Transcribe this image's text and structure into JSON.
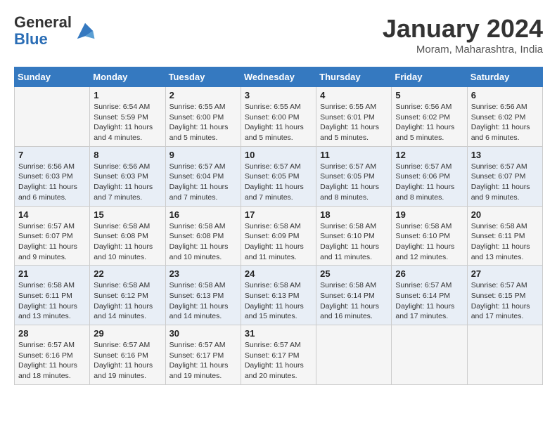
{
  "header": {
    "logo": {
      "line1": "General",
      "line2": "Blue"
    },
    "title": "January 2024",
    "location": "Moram, Maharashtra, India"
  },
  "weekdays": [
    "Sunday",
    "Monday",
    "Tuesday",
    "Wednesday",
    "Thursday",
    "Friday",
    "Saturday"
  ],
  "weeks": [
    [
      {
        "day": "",
        "info": ""
      },
      {
        "day": "1",
        "info": "Sunrise: 6:54 AM\nSunset: 5:59 PM\nDaylight: 11 hours\nand 4 minutes."
      },
      {
        "day": "2",
        "info": "Sunrise: 6:55 AM\nSunset: 6:00 PM\nDaylight: 11 hours\nand 5 minutes."
      },
      {
        "day": "3",
        "info": "Sunrise: 6:55 AM\nSunset: 6:00 PM\nDaylight: 11 hours\nand 5 minutes."
      },
      {
        "day": "4",
        "info": "Sunrise: 6:55 AM\nSunset: 6:01 PM\nDaylight: 11 hours\nand 5 minutes."
      },
      {
        "day": "5",
        "info": "Sunrise: 6:56 AM\nSunset: 6:02 PM\nDaylight: 11 hours\nand 5 minutes."
      },
      {
        "day": "6",
        "info": "Sunrise: 6:56 AM\nSunset: 6:02 PM\nDaylight: 11 hours\nand 6 minutes."
      }
    ],
    [
      {
        "day": "7",
        "info": "Sunrise: 6:56 AM\nSunset: 6:03 PM\nDaylight: 11 hours\nand 6 minutes."
      },
      {
        "day": "8",
        "info": "Sunrise: 6:56 AM\nSunset: 6:03 PM\nDaylight: 11 hours\nand 7 minutes."
      },
      {
        "day": "9",
        "info": "Sunrise: 6:57 AM\nSunset: 6:04 PM\nDaylight: 11 hours\nand 7 minutes."
      },
      {
        "day": "10",
        "info": "Sunrise: 6:57 AM\nSunset: 6:05 PM\nDaylight: 11 hours\nand 7 minutes."
      },
      {
        "day": "11",
        "info": "Sunrise: 6:57 AM\nSunset: 6:05 PM\nDaylight: 11 hours\nand 8 minutes."
      },
      {
        "day": "12",
        "info": "Sunrise: 6:57 AM\nSunset: 6:06 PM\nDaylight: 11 hours\nand 8 minutes."
      },
      {
        "day": "13",
        "info": "Sunrise: 6:57 AM\nSunset: 6:07 PM\nDaylight: 11 hours\nand 9 minutes."
      }
    ],
    [
      {
        "day": "14",
        "info": "Sunrise: 6:57 AM\nSunset: 6:07 PM\nDaylight: 11 hours\nand 9 minutes."
      },
      {
        "day": "15",
        "info": "Sunrise: 6:58 AM\nSunset: 6:08 PM\nDaylight: 11 hours\nand 10 minutes."
      },
      {
        "day": "16",
        "info": "Sunrise: 6:58 AM\nSunset: 6:08 PM\nDaylight: 11 hours\nand 10 minutes."
      },
      {
        "day": "17",
        "info": "Sunrise: 6:58 AM\nSunset: 6:09 PM\nDaylight: 11 hours\nand 11 minutes."
      },
      {
        "day": "18",
        "info": "Sunrise: 6:58 AM\nSunset: 6:10 PM\nDaylight: 11 hours\nand 11 minutes."
      },
      {
        "day": "19",
        "info": "Sunrise: 6:58 AM\nSunset: 6:10 PM\nDaylight: 11 hours\nand 12 minutes."
      },
      {
        "day": "20",
        "info": "Sunrise: 6:58 AM\nSunset: 6:11 PM\nDaylight: 11 hours\nand 13 minutes."
      }
    ],
    [
      {
        "day": "21",
        "info": "Sunrise: 6:58 AM\nSunset: 6:11 PM\nDaylight: 11 hours\nand 13 minutes."
      },
      {
        "day": "22",
        "info": "Sunrise: 6:58 AM\nSunset: 6:12 PM\nDaylight: 11 hours\nand 14 minutes."
      },
      {
        "day": "23",
        "info": "Sunrise: 6:58 AM\nSunset: 6:13 PM\nDaylight: 11 hours\nand 14 minutes."
      },
      {
        "day": "24",
        "info": "Sunrise: 6:58 AM\nSunset: 6:13 PM\nDaylight: 11 hours\nand 15 minutes."
      },
      {
        "day": "25",
        "info": "Sunrise: 6:58 AM\nSunset: 6:14 PM\nDaylight: 11 hours\nand 16 minutes."
      },
      {
        "day": "26",
        "info": "Sunrise: 6:57 AM\nSunset: 6:14 PM\nDaylight: 11 hours\nand 17 minutes."
      },
      {
        "day": "27",
        "info": "Sunrise: 6:57 AM\nSunset: 6:15 PM\nDaylight: 11 hours\nand 17 minutes."
      }
    ],
    [
      {
        "day": "28",
        "info": "Sunrise: 6:57 AM\nSunset: 6:16 PM\nDaylight: 11 hours\nand 18 minutes."
      },
      {
        "day": "29",
        "info": "Sunrise: 6:57 AM\nSunset: 6:16 PM\nDaylight: 11 hours\nand 19 minutes."
      },
      {
        "day": "30",
        "info": "Sunrise: 6:57 AM\nSunset: 6:17 PM\nDaylight: 11 hours\nand 19 minutes."
      },
      {
        "day": "31",
        "info": "Sunrise: 6:57 AM\nSunset: 6:17 PM\nDaylight: 11 hours\nand 20 minutes."
      },
      {
        "day": "",
        "info": ""
      },
      {
        "day": "",
        "info": ""
      },
      {
        "day": "",
        "info": ""
      }
    ]
  ]
}
